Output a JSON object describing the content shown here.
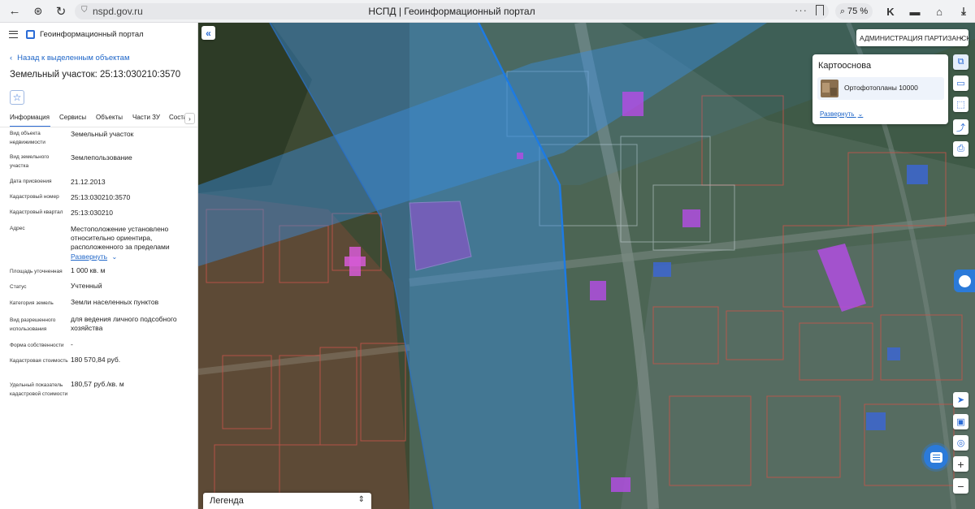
{
  "browser": {
    "url": "nspd.gov.ru",
    "title": "НСПД | Геоинформационный портал",
    "dots": "···",
    "zoom": "75 %"
  },
  "sidebar": {
    "portal_title": "Геоинформационный портал",
    "back_link": "Назад к выделенным объектам",
    "title": "Земельный участок: 25:13:030210:3570",
    "tabs": [
      {
        "label": "Информация",
        "active": true
      },
      {
        "label": "Сервисы"
      },
      {
        "label": "Объекты"
      },
      {
        "label": "Части ЗУ"
      },
      {
        "label": "Соста"
      }
    ],
    "properties": [
      {
        "label": "Вид объекта недвижимости",
        "value": "Земельный участок"
      },
      {
        "label": "Вид земельного участка",
        "value": "Землепользование"
      },
      {
        "label": "Дата присвоения",
        "value": "21.12.2013"
      },
      {
        "label": "Кадастровый номер",
        "value": "25:13:030210:3570"
      },
      {
        "label": "Кадастровый квартал",
        "value": "25:13:030210"
      },
      {
        "label": "Адрес",
        "value": "Местоположение установлено относительно ориентира, расположенного за пределами",
        "expand": "Развернуть"
      },
      {
        "label": "Площадь уточненная",
        "value": "1 000 кв. м"
      },
      {
        "label": "Статус",
        "value": "Учтенный"
      },
      {
        "label": "Категория земель",
        "value": "Земли населенных пунктов"
      },
      {
        "label": "Вид разрешенного использования",
        "value": "для ведения личного подсобного хозяйства"
      },
      {
        "label": "Форма собственности",
        "value": "-"
      },
      {
        "label": "Кадастровая стоимость",
        "value": "180 570,84 руб."
      },
      {
        "label": "Удельный показатель кадастровой стоимости",
        "value": "180,57 руб./кв. м"
      }
    ]
  },
  "map": {
    "layer_select": "АДМИНИСТРАЦИЯ ПАРТИЗАНСКОГО",
    "basemap": {
      "title": "Картооснова",
      "item": "Ортофотопланы 10000",
      "expand": "Развернуть"
    },
    "legend": "Легенда"
  },
  "colors": {
    "accent": "#2b6cd6",
    "zone_overlay": "#3a8fe0",
    "parcel_highlight": "#9b4dd6",
    "buildings": "#b04de0"
  }
}
